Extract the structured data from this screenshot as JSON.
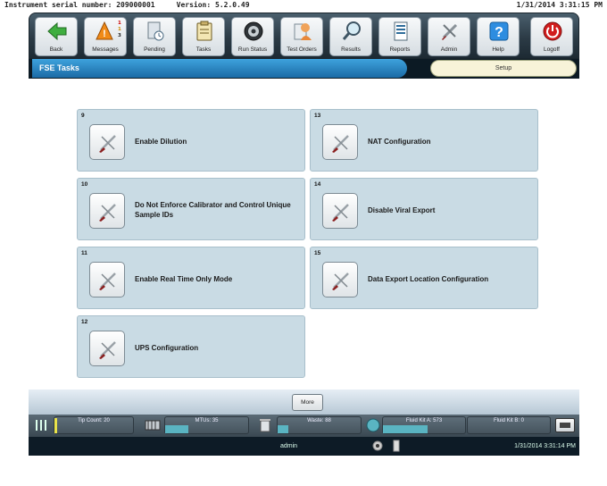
{
  "header": {
    "serial_line": "Instrument serial number: 209000001     Version: 5.2.0.49",
    "timestamp": "1/31/2014 3:31:15 PM"
  },
  "toolbar": {
    "back": "Back",
    "messages": "Messages",
    "message_counts": [
      "1",
      "1",
      "3"
    ],
    "pending": "Pending",
    "tasks": "Tasks",
    "run_status": "Run Status",
    "test_orders": "Test Orders",
    "results": "Results",
    "reports": "Reports",
    "admin": "Admin",
    "help": "Help",
    "logoff": "Logoff"
  },
  "titlebar": {
    "title": "FSE Tasks",
    "setup_tab": "Setup"
  },
  "tasks": [
    {
      "number": "9",
      "label": "Enable Dilution"
    },
    {
      "number": "10",
      "label": "Do Not Enforce Calibrator and Control Unique Sample IDs"
    },
    {
      "number": "11",
      "label": "Enable Real Time Only Mode"
    },
    {
      "number": "12",
      "label": "UPS Configuration"
    },
    {
      "number": "13",
      "label": "NAT Configuration"
    },
    {
      "number": "14",
      "label": "Disable Viral Export"
    },
    {
      "number": "15",
      "label": "Data Export Location Configuration"
    }
  ],
  "more_button": "More",
  "status": {
    "tip_count": "Tip Count: 20",
    "mtus": "MTUs: 35",
    "waste": "Waste: 88",
    "fluid_kit_a": "Fluid Kit A: 573",
    "fluid_kit_b": "Fluid Kit B: 0"
  },
  "bottom": {
    "user": "admin",
    "clock": "1/31/2014 3:31:14 PM"
  },
  "colors": {
    "accent": "#1f78b8",
    "card_bg": "#c9dbe4",
    "logoff": "#d11d1d"
  },
  "icons": [
    "back-arrow-icon",
    "warning-icon",
    "hourglass-icon",
    "clipboard-icon",
    "disk-icon",
    "flask-icon",
    "magnifier-icon",
    "document-icon",
    "tools-icon",
    "question-icon",
    "power-icon"
  ]
}
